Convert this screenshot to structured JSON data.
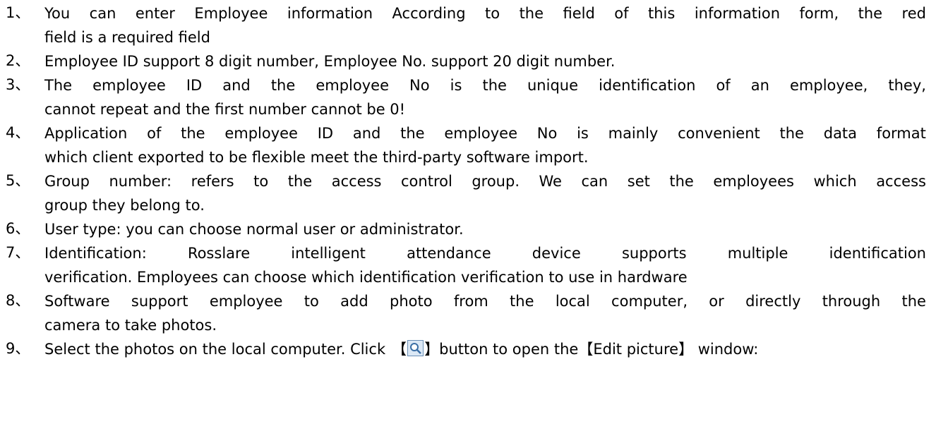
{
  "items": [
    {
      "num": "1、",
      "first_words": [
        "You",
        "can",
        "enter",
        "Employee",
        "information",
        "According",
        "to",
        "the",
        "field",
        "of",
        "this",
        "information",
        "form,",
        "the",
        "red"
      ],
      "continuation": "field is a required field"
    },
    {
      "num": "2、",
      "first_words": [
        "Employee ID support 8 digit number, Employee No. support 20 digit number."
      ],
      "continuation": ""
    },
    {
      "num": "3、",
      "first_words": [
        "The",
        "employee",
        "ID",
        "and",
        "the",
        "employee",
        "No",
        "is",
        "the",
        "unique",
        "identification",
        "of",
        "an",
        "employee,",
        "they,"
      ],
      "continuation": "cannot repeat and the first number cannot be 0!"
    },
    {
      "num": "4、",
      "first_words": [
        "Application",
        "of",
        "the",
        "employee",
        "ID",
        "and",
        "the",
        "employee",
        "No",
        "is",
        "mainly",
        "convenient",
        "the",
        "data",
        "format"
      ],
      "continuation": "which client exported to be flexible meet the third-party software import."
    },
    {
      "num": "5、",
      "first_words": [
        "Group",
        "number:",
        "refers",
        "to",
        "the",
        "access",
        "control",
        "group.",
        "We",
        "can",
        "set",
        "the",
        "employees",
        "which",
        "access"
      ],
      "continuation": "group they belong to."
    },
    {
      "num": "6、",
      "first_words": [
        "User type: you can choose normal user or administrator."
      ],
      "continuation": ""
    },
    {
      "num": "7、",
      "first_words": [
        "Identification:",
        "Rosslare",
        "intelligent",
        "attendance",
        "device",
        "supports",
        "multiple",
        "identification"
      ],
      "continuation": "verification. Employees can choose which identification verification to use in hardware"
    },
    {
      "num": "8、",
      "first_words": [
        "Software",
        "support",
        "employee",
        "to",
        "add",
        "photo",
        "from",
        "the",
        "local",
        "computer,",
        "or",
        "directly",
        "through",
        "the"
      ],
      "continuation": "camera to take photos."
    }
  ],
  "item9": {
    "num": "9、",
    "before": "Select the photos on the local computer. Click",
    "bracket_open": "【",
    "bracket_close": "】",
    "after_button": "button to open the",
    "window_open": "【",
    "window_name": "Edit picture",
    "window_close": "】",
    "tail": " window:",
    "icon": "magnifier-icon"
  }
}
